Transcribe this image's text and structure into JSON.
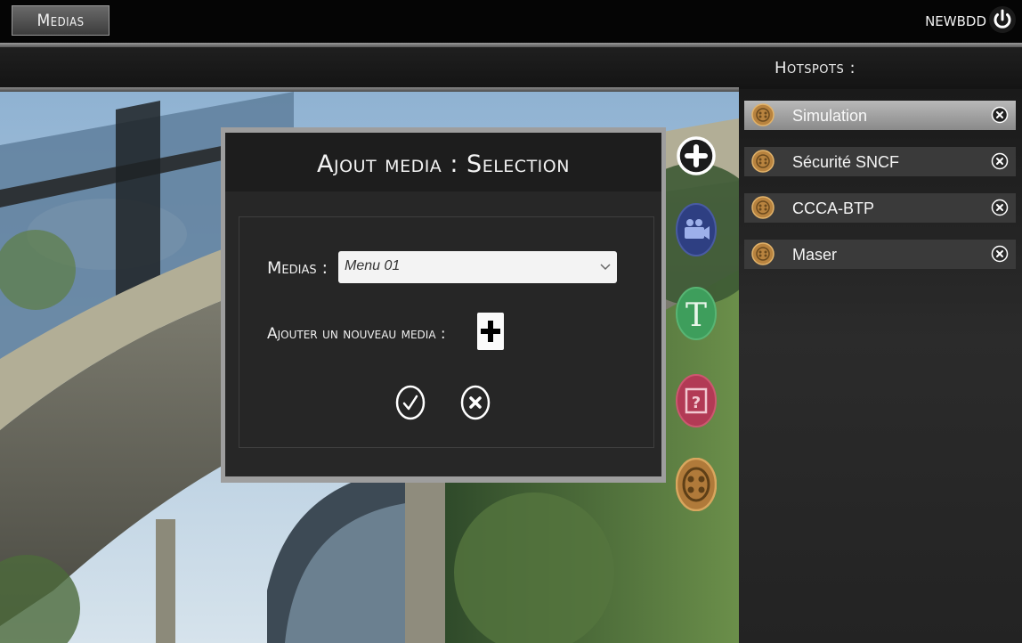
{
  "topbar": {
    "medias_tab": "Medias",
    "user": "NEWBDD"
  },
  "hotspots": {
    "title": "Hotspots :",
    "items": [
      {
        "label": "Simulation",
        "selected": true
      },
      {
        "label": "Sécurité SNCF",
        "selected": false
      },
      {
        "label": "CCCA-BTP",
        "selected": false
      },
      {
        "label": "Maser",
        "selected": false
      }
    ]
  },
  "tools": [
    {
      "name": "add-tool",
      "icon": "plus-circle-icon",
      "color": "#ffffff"
    },
    {
      "name": "video-tool",
      "icon": "video-camera-icon",
      "color": "#34468a"
    },
    {
      "name": "text-tool",
      "icon": "text-t-icon",
      "color": "#3d9a5a"
    },
    {
      "name": "quiz-tool",
      "icon": "question-icon",
      "color": "#b9384f"
    },
    {
      "name": "hotspot-tool",
      "icon": "hotspot-medallion-icon",
      "color": "#b07a3a"
    }
  ],
  "dialog": {
    "title": "Ajout media : Selection",
    "medias_label": "Medias :",
    "medias_value": "Menu 01",
    "add_label": "Ajouter un nouveau media :"
  },
  "colors": {
    "accent_gold": "#c99a52",
    "selected_bg": "#a3a3a3",
    "item_bg": "#3a3a3a"
  }
}
